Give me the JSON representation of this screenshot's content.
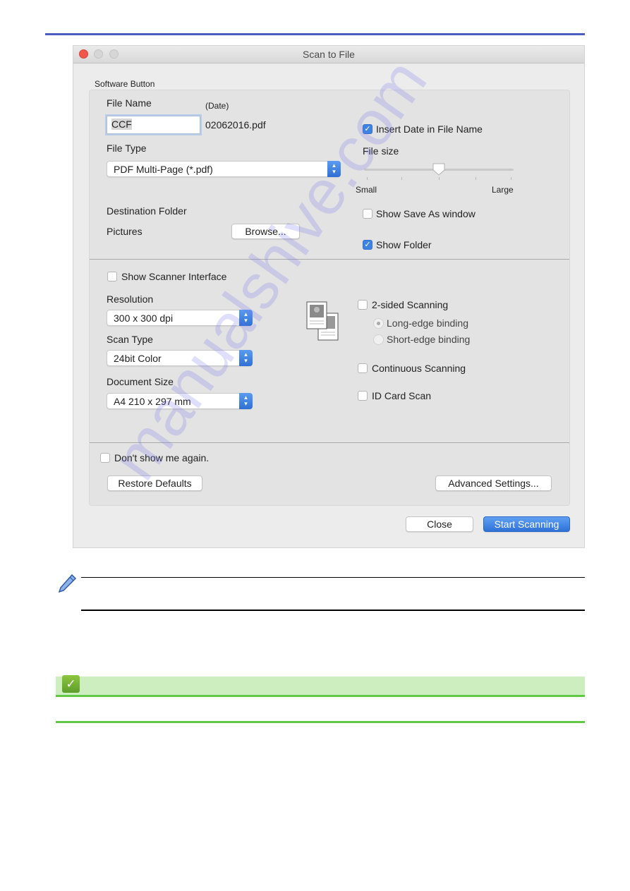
{
  "window": {
    "title": "Scan to File",
    "section_label": "Software Button"
  },
  "file": {
    "name_label": "File Name",
    "date_label": "(Date)",
    "name_value": "CCF",
    "date_suffix": "02062016.pdf",
    "type_label": "File Type",
    "type_value": "PDF Multi-Page (*.pdf)",
    "insert_date_label": "Insert Date in File Name",
    "insert_date_checked": true,
    "size_label": "File size",
    "size_small": "Small",
    "size_large": "Large",
    "size_level_fraction": 0.5,
    "dest_label": "Destination Folder",
    "dest_value": "Pictures",
    "browse_label": "Browse...",
    "show_save_as_label": "Show Save As window",
    "show_save_as_checked": false,
    "show_folder_label": "Show Folder",
    "show_folder_checked": true
  },
  "scan": {
    "show_interface_label": "Show Scanner Interface",
    "show_interface_checked": false,
    "resolution_label": "Resolution",
    "resolution_value": "300 x 300 dpi",
    "scan_type_label": "Scan Type",
    "scan_type_value": "24bit Color",
    "doc_size_label": "Document Size",
    "doc_size_value": "A4 210 x 297 mm",
    "two_sided_label": "2-sided Scanning",
    "two_sided_checked": false,
    "long_edge_label": "Long-edge binding",
    "short_edge_label": "Short-edge binding",
    "binding_selected": "Long-edge binding",
    "continuous_label": "Continuous Scanning",
    "continuous_checked": false,
    "id_card_label": "ID Card Scan",
    "id_card_checked": false
  },
  "footer": {
    "dont_show_label": "Don't show me again.",
    "dont_show_checked": false,
    "restore_label": "Restore Defaults",
    "advanced_label": "Advanced Settings...",
    "close_label": "Close",
    "start_label": "Start Scanning"
  },
  "icons": {
    "stepper": "⌃⌄",
    "check": "✓",
    "related_check": "✓"
  },
  "colors": {
    "accent": "#3f83e0",
    "top_rule": "#4a5fbf",
    "related_bar": "#cdefc0",
    "related_line": "#62c744"
  },
  "watermark": "manualshive.com"
}
